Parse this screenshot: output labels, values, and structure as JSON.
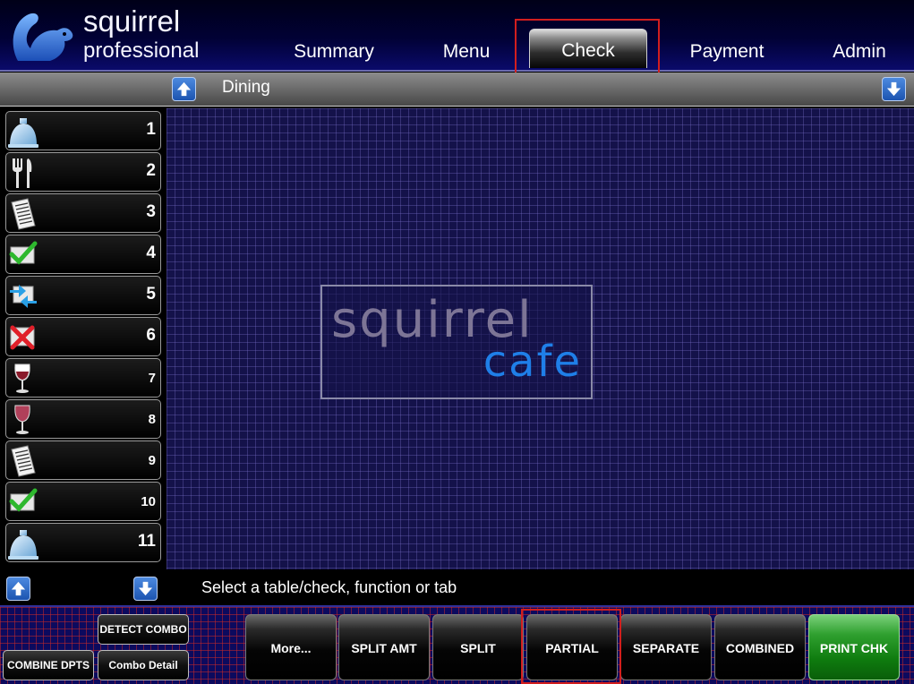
{
  "brand": {
    "line1": "squirrel",
    "line2": "professional"
  },
  "nav": {
    "tabs": [
      {
        "label": "Summary",
        "active": false
      },
      {
        "label": "Menu",
        "active": false
      },
      {
        "label": "Check",
        "active": true
      },
      {
        "label": "Payment",
        "active": false
      },
      {
        "label": "Admin",
        "active": false
      }
    ]
  },
  "section": {
    "title": "Dining"
  },
  "tables": [
    {
      "number": "1",
      "icon": "cloche-icon"
    },
    {
      "number": "2",
      "icon": "fork-knife-icon"
    },
    {
      "number": "3",
      "icon": "receipt-icon"
    },
    {
      "number": "4",
      "icon": "checkmark-icon"
    },
    {
      "number": "5",
      "icon": "transfer-arrows-icon"
    },
    {
      "number": "6",
      "icon": "red-x-icon"
    },
    {
      "number": "7",
      "icon": "empty-wine-glass-icon"
    },
    {
      "number": "8",
      "icon": "wine-glass-icon"
    },
    {
      "number": "9",
      "icon": "receipt-icon"
    },
    {
      "number": "10",
      "icon": "checkmark-icon"
    },
    {
      "number": "11",
      "icon": "cloche-icon"
    }
  ],
  "floor": {
    "logo_word1": "squirrel",
    "logo_word2": "cafe"
  },
  "status": {
    "message": "Select a table/check, function or tab"
  },
  "functions": {
    "detect_combo": "DETECT COMBO",
    "combine_dpts": "COMBINE DPTS",
    "combo_detail": "Combo Detail",
    "buttons": [
      "More...",
      "SPLIT AMT",
      "SPLIT",
      "PARTIAL",
      "SEPARATE",
      "COMBINED",
      "PRINT CHK"
    ]
  },
  "colors": {
    "accent_blue": "#1f7fe8",
    "highlight_red": "#d21e1e",
    "print_green": "#2fa02f",
    "header_navy": "#010135"
  }
}
